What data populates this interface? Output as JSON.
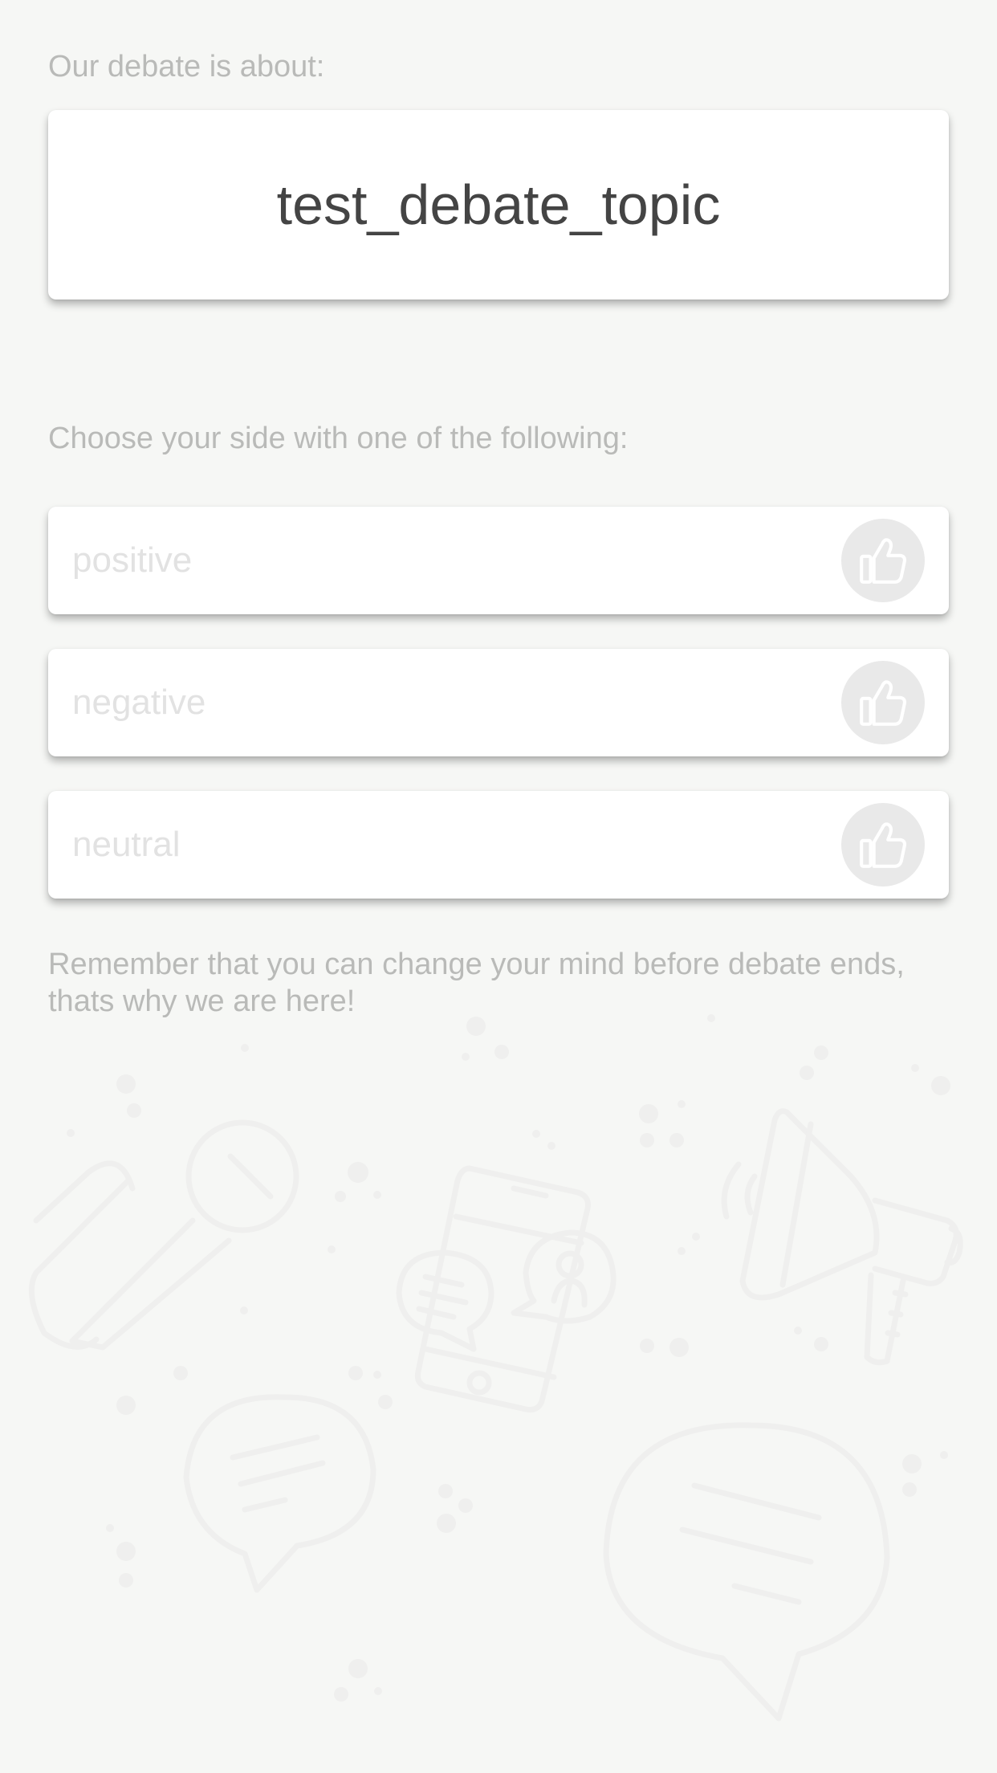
{
  "header": {
    "intro_label": "Our debate is about:"
  },
  "topic": {
    "title": "test_debate_topic"
  },
  "sides": {
    "prompt": "Choose your side with one of the following:",
    "options": [
      {
        "label": "positive",
        "icon": "thumbs-up-icon"
      },
      {
        "label": "negative",
        "icon": "thumbs-up-icon"
      },
      {
        "label": "neutral",
        "icon": "thumbs-up-icon"
      }
    ]
  },
  "footer": {
    "note": "Remember that you can change your mind before debate ends, thats why we are here!"
  },
  "colors": {
    "background": "#f6f7f5",
    "label_text": "#b9bab8",
    "topic_text": "#444444",
    "option_text": "#e2e2e2",
    "icon_circle": "#e9e9e9"
  }
}
